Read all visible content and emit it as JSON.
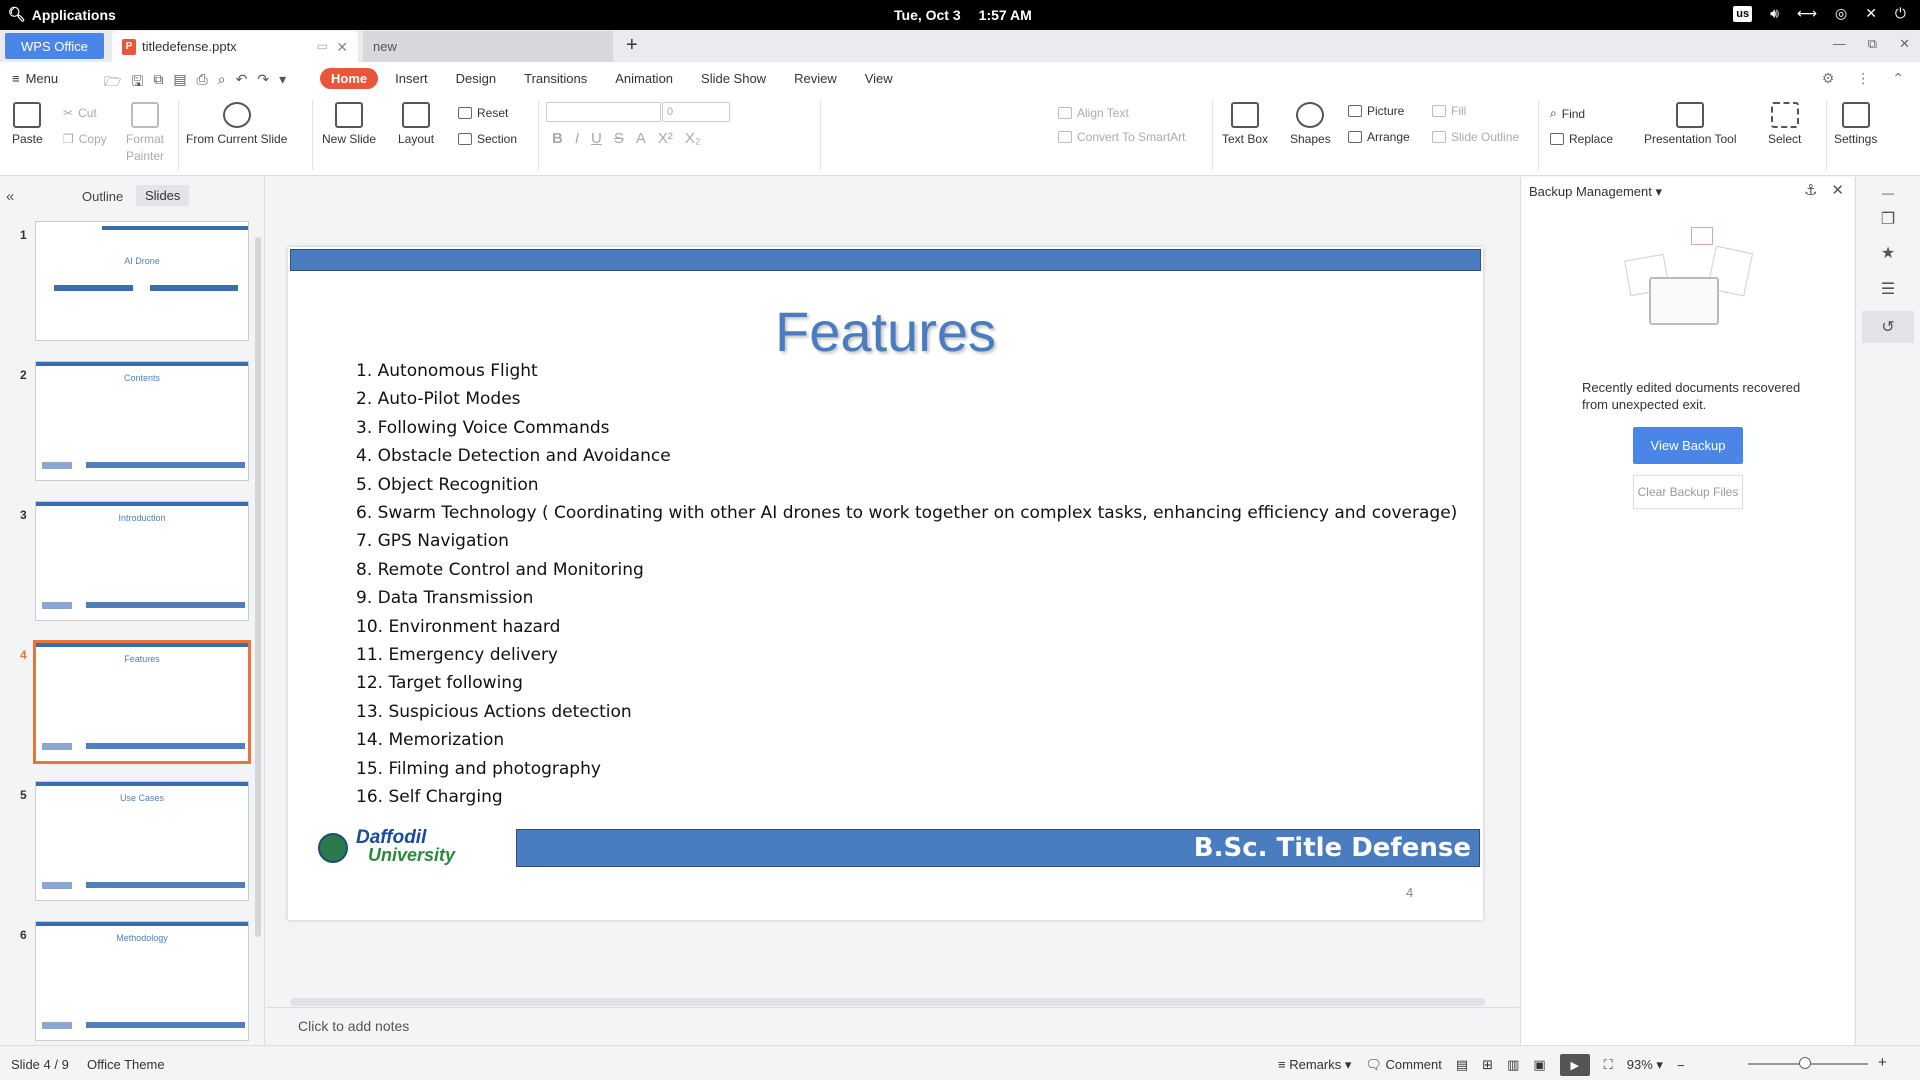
{
  "system": {
    "apps_label": "Applications",
    "date": "Tue, Oct  3",
    "time": "1:57 AM",
    "lang": "us"
  },
  "tabs": {
    "wps": "WPS Office",
    "doc": "titledefense.pptx",
    "new": "new"
  },
  "menu": {
    "menu_label": "Menu",
    "tabs": [
      "Home",
      "Insert",
      "Design",
      "Transitions",
      "Animation",
      "Slide Show",
      "Review",
      "View"
    ]
  },
  "ribbon": {
    "paste": "Paste",
    "cut": "Cut",
    "copy": "Copy",
    "format_painter": "Format Painter",
    "from_current": "From Current Slide",
    "new_slide": "New Slide",
    "layout": "Layout",
    "reset": "Reset",
    "section": "Section",
    "font_size": "0",
    "align_text": "Align Text",
    "convert_smartart": "Convert To SmartArt",
    "text_box": "Text Box",
    "shapes": "Shapes",
    "picture": "Picture",
    "arrange": "Arrange",
    "fill": "Fill",
    "slide_outline": "Slide Outline",
    "find": "Find",
    "replace": "Replace",
    "presentation_tool": "Presentation Tool",
    "select": "Select",
    "settings": "Settings"
  },
  "left_panel": {
    "outline": "Outline",
    "slides": "Slides"
  },
  "thumbnails": [
    {
      "num": "1",
      "title": "AI Drone"
    },
    {
      "num": "2",
      "title": "Contents"
    },
    {
      "num": "3",
      "title": "Introduction"
    },
    {
      "num": "4",
      "title": "Features"
    },
    {
      "num": "5",
      "title": "Use Cases"
    },
    {
      "num": "6",
      "title": "Methodology"
    }
  ],
  "slide": {
    "title": "Features",
    "items": [
      "1. Autonomous Flight",
      "2. Auto-Pilot Modes",
      "3. Following Voice Commands",
      "4. Obstacle Detection and Avoidance",
      "5. Object Recognition",
      "6. Swarm Technology ( Coordinating with other AI drones to work together on complex tasks, enhancing efficiency and coverage)",
      "7. GPS Navigation",
      "8. Remote Control and Monitoring",
      "9. Data Transmission",
      "10. Environment hazard",
      "11. Emergency delivery",
      "12. Target following",
      "13. Suspicious Actions detection",
      "14. Memorization",
      "15. Filming and photography",
      "16. Self Charging"
    ],
    "logo_line1": "Daffodil",
    "logo_line2": "University",
    "footer": "B.Sc. Title Defense",
    "page_number": "4"
  },
  "notes_placeholder": "Click to add notes",
  "backup": {
    "title": "Backup Management",
    "message": "Recently edited documents recovered from unexpected exit.",
    "view_button": "View Backup",
    "clear_button": "Clear Backup Files"
  },
  "status": {
    "slide_info": "Slide 4 / 9",
    "theme": "Office Theme",
    "remarks": "Remarks",
    "comment": "Comment",
    "zoom": "93%"
  }
}
